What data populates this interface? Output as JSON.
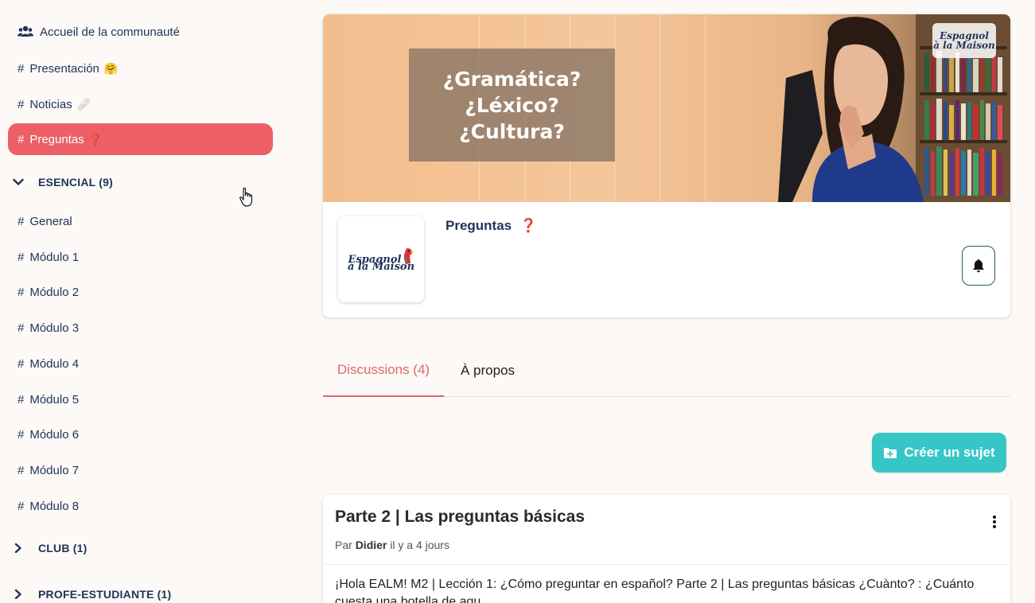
{
  "sidebar": {
    "community": "Accueil de la communauté",
    "channels_top": [
      {
        "label": "Presentación",
        "emoji": "🤗"
      },
      {
        "label": "Noticias",
        "emoji": "🩹"
      },
      {
        "label": "Preguntas",
        "emoji": "❓"
      }
    ],
    "sections": [
      {
        "label": "ESENCIAL (9)",
        "expanded": true
      },
      {
        "label": "CLUB (1)",
        "expanded": false
      },
      {
        "label": "PROFE-ESTUDIANTE (1)",
        "expanded": false
      }
    ],
    "esencial_items": [
      "General",
      "Módulo 1",
      "Módulo 2",
      "Módulo 3",
      "Módulo 4",
      "Módulo 5",
      "Módulo 6",
      "Módulo 7",
      "Módulo 8"
    ]
  },
  "banner": {
    "lines": [
      "¿Gramática?",
      "¿Léxico?",
      "¿Cultura?"
    ],
    "logo": {
      "line1": "Espagnol",
      "line2": "à la Maison"
    }
  },
  "channel": {
    "title": "Preguntas",
    "emoji": "❓",
    "logo": {
      "line1": "Espagnol",
      "line2": "à la Maison"
    }
  },
  "tabs": {
    "discussions": "Discussions (4)",
    "about": "À propos"
  },
  "create_button": "Créer un sujet",
  "post": {
    "title": "Parte 2 | Las preguntas básicas",
    "by": "Par",
    "author": "Didier",
    "time": "il y a 4 jours",
    "body": "¡Hola EALM! M2 | Lección 1: ¿Cómo preguntar en español? Parte 2 | Las preguntas básicas ¿Cuànto? : ¿Cuánto cuesta una botella de agu"
  },
  "colors": {
    "active_channel": "#ec5f66",
    "navy": "#1f3358",
    "accent_tab": "#e0676c",
    "create_button": "#37c6c6"
  }
}
